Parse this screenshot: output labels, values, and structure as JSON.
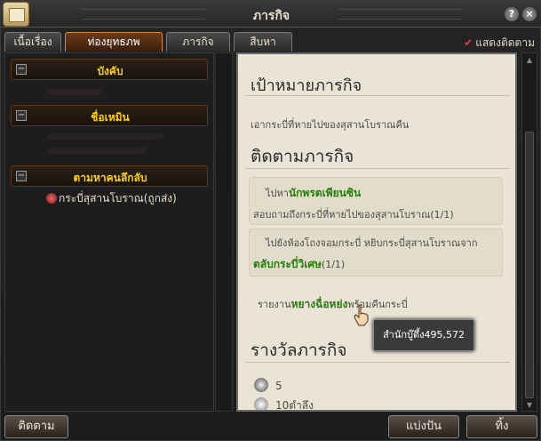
{
  "window": {
    "title": "ภารกิจ",
    "help": "?",
    "close": "×"
  },
  "tabs": [
    {
      "label": "เนื้อเรื่อง"
    },
    {
      "label": "ท่องยุทธภพ"
    },
    {
      "label": "ภารกิจแนะนำ"
    },
    {
      "label": "สืบหาปริศนา"
    }
  ],
  "show_tracking": {
    "label": "แสดงติดตาม",
    "checked": true
  },
  "categories": [
    {
      "label": "บังคับ",
      "toggle": "−"
    },
    {
      "label": "ชื่อเหมิน",
      "toggle": "−"
    },
    {
      "label": "ตามหาคนลึกลับ",
      "toggle": "−"
    }
  ],
  "quest_list": {
    "selected_item": "กระบี่สุสานโบราณ(ถูกส่ง)"
  },
  "detail": {
    "objective_heading": "เป้าหมายภารกิจ",
    "objective_text": "เอากระบี่ที่หายไปของสุสานโบราณคืน",
    "tracking_heading": "ติดตามภารกิจ",
    "track1_prefix": "ไปหา",
    "track1_name": "นักพรตเพียนซิน",
    "track1_detail": "สอบถามถึงกระบี่ที่หายไปของสุสานโบราณ(1/1)",
    "track2_prefix": "ไปยังห้องโถงจอมกระบี่ หยิบกระบี่สุสานโบราณจาก",
    "track2_name": "ตลับกระบี่วิเศษ",
    "track2_count": "(1/1)",
    "report_prefix": "รายงาน",
    "report_name": "หยางฉื่อหย่ง",
    "report_suffix": "พร้อมคืนกระบี่",
    "reward_heading": "รางวัลภารกิจ",
    "reward1_value": "5",
    "reward2_value": "10ตำลึง"
  },
  "tooltip": {
    "text": "สำนักบู๊ตึ้ง495,572"
  },
  "buttons": {
    "track": "ติดตาม",
    "share": "แบ่งปัน",
    "abandon": "ทิ้ง"
  },
  "colors": {
    "accent_yellow": "#ffd200",
    "highlight_green": "#2a7a10",
    "tab_active": "#6b3b1a",
    "parchment": "#e9e4d6"
  }
}
